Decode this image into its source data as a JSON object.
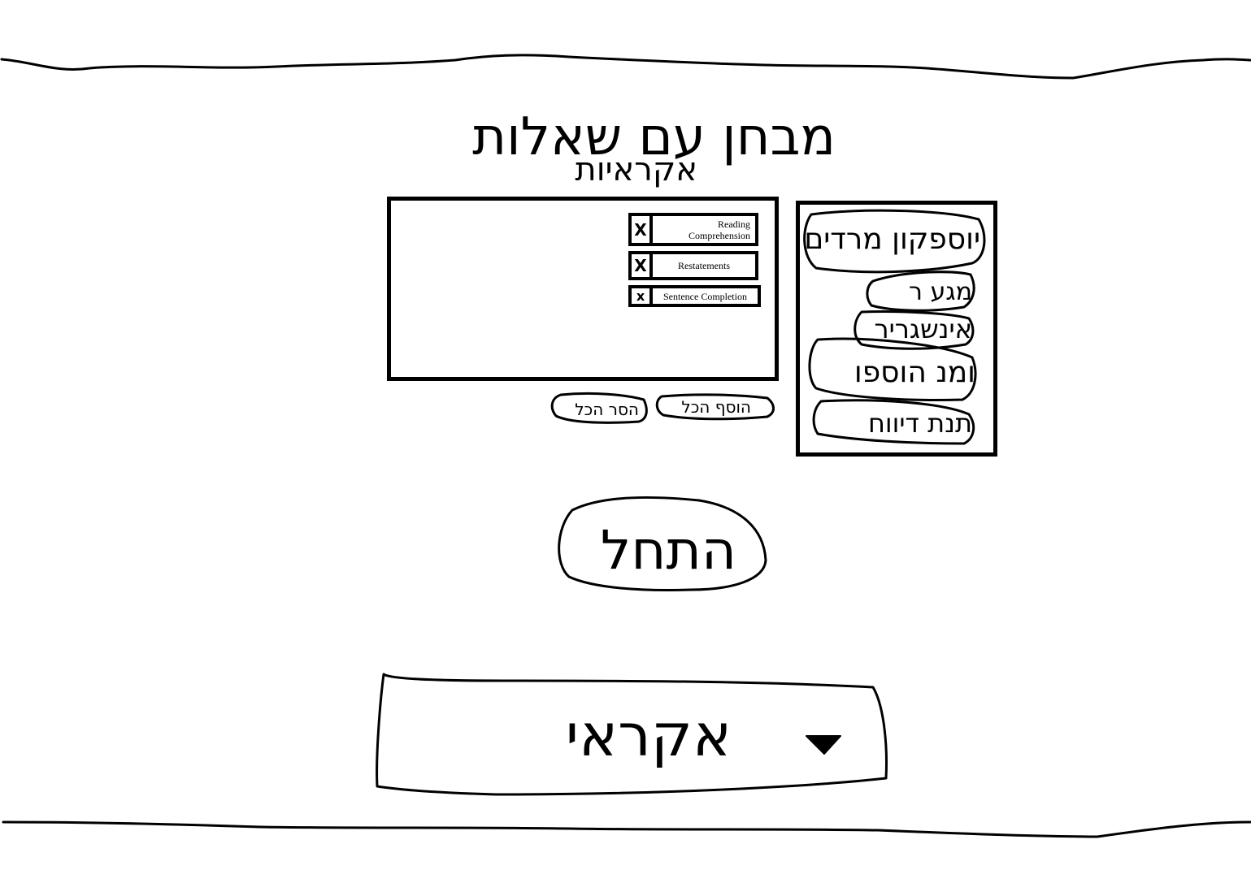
{
  "page": {
    "title_line1": "מבחן עם שאלות",
    "title_line2": "אקראיות"
  },
  "selected_panel": {
    "tags": [
      {
        "remove_glyph": "X",
        "label": "Reading Comprehension"
      },
      {
        "remove_glyph": "X",
        "label": "Restatements"
      },
      {
        "remove_glyph": "x",
        "label": "Sentence Completion"
      }
    ]
  },
  "buttons": {
    "remove_all": "הסר הכל",
    "add_all": "הוסף הכל",
    "start": "התחל"
  },
  "categories_panel": {
    "items": [
      {
        "label": "יוספקון מרדים"
      },
      {
        "label": "מגע ר"
      },
      {
        "label": "אינשגריר"
      },
      {
        "label": "ומנ הוספו"
      },
      {
        "label": "תנת דיווח"
      }
    ]
  },
  "mode_select": {
    "selected": "אקראי"
  }
}
